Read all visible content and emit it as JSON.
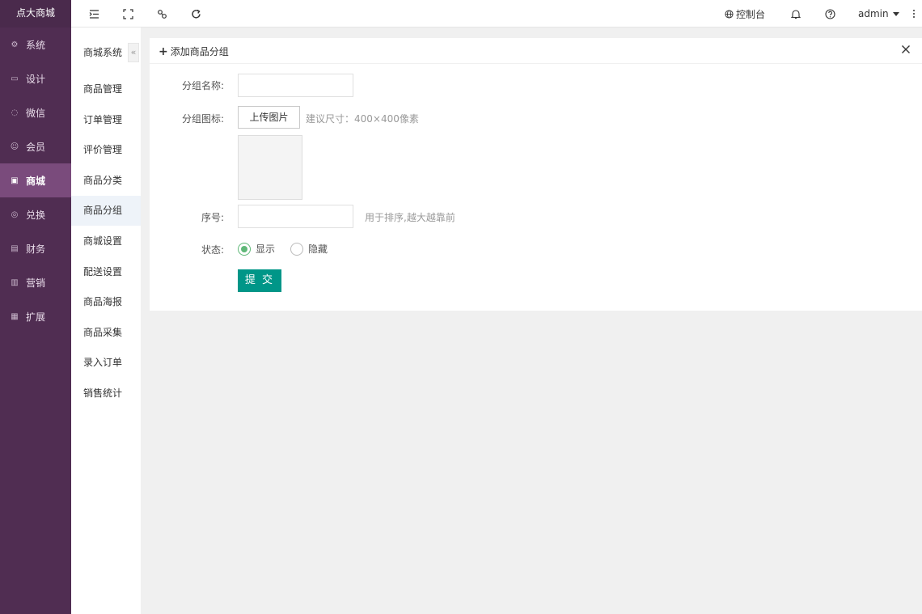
{
  "brand": "点大商城",
  "side_menu": [
    {
      "label": "系统",
      "icon": "gear-icon",
      "active": false
    },
    {
      "label": "设计",
      "icon": "monitor-icon",
      "active": false
    },
    {
      "label": "微信",
      "icon": "wechat-icon",
      "active": false
    },
    {
      "label": "会员",
      "icon": "user-icon",
      "active": false
    },
    {
      "label": "商城",
      "icon": "shop-icon",
      "active": true
    },
    {
      "label": "兑换",
      "icon": "exchange-icon",
      "active": false
    },
    {
      "label": "财务",
      "icon": "finance-icon",
      "active": false
    },
    {
      "label": "营销",
      "icon": "gift-icon",
      "active": false
    },
    {
      "label": "扩展",
      "icon": "grid-icon",
      "active": false
    }
  ],
  "topbar": {
    "console_label": "控制台",
    "user": "admin"
  },
  "subnav": {
    "title": "商城系统",
    "collapse_glyph": "«",
    "items": [
      {
        "label": "商品管理",
        "active": false
      },
      {
        "label": "订单管理",
        "active": false
      },
      {
        "label": "评价管理",
        "active": false
      },
      {
        "label": "商品分类",
        "active": false
      },
      {
        "label": "商品分组",
        "active": true
      },
      {
        "label": "商城设置",
        "active": false
      },
      {
        "label": "配送设置",
        "active": false
      },
      {
        "label": "商品海报",
        "active": false
      },
      {
        "label": "商品采集",
        "active": false
      },
      {
        "label": "录入订单",
        "active": false
      },
      {
        "label": "销售统计",
        "active": false
      }
    ]
  },
  "form": {
    "title": "添加商品分组",
    "name_label": "分组名称:",
    "name_value": "",
    "icon_label": "分组图标:",
    "upload_label": "上传图片",
    "icon_hint": "建议尺寸：400×400像素",
    "order_label": "序号:",
    "order_value": "",
    "order_hint": "用于排序,越大越靠前",
    "status_label": "状态:",
    "status_show": "显示",
    "status_hide": "隐藏",
    "status_selected": "显示",
    "submit_label": "提 交"
  },
  "colors": {
    "sidebar": "#502d52",
    "sidebar_active": "#7a4b7c",
    "submit": "#009688",
    "radio_on": "#5fb878"
  }
}
